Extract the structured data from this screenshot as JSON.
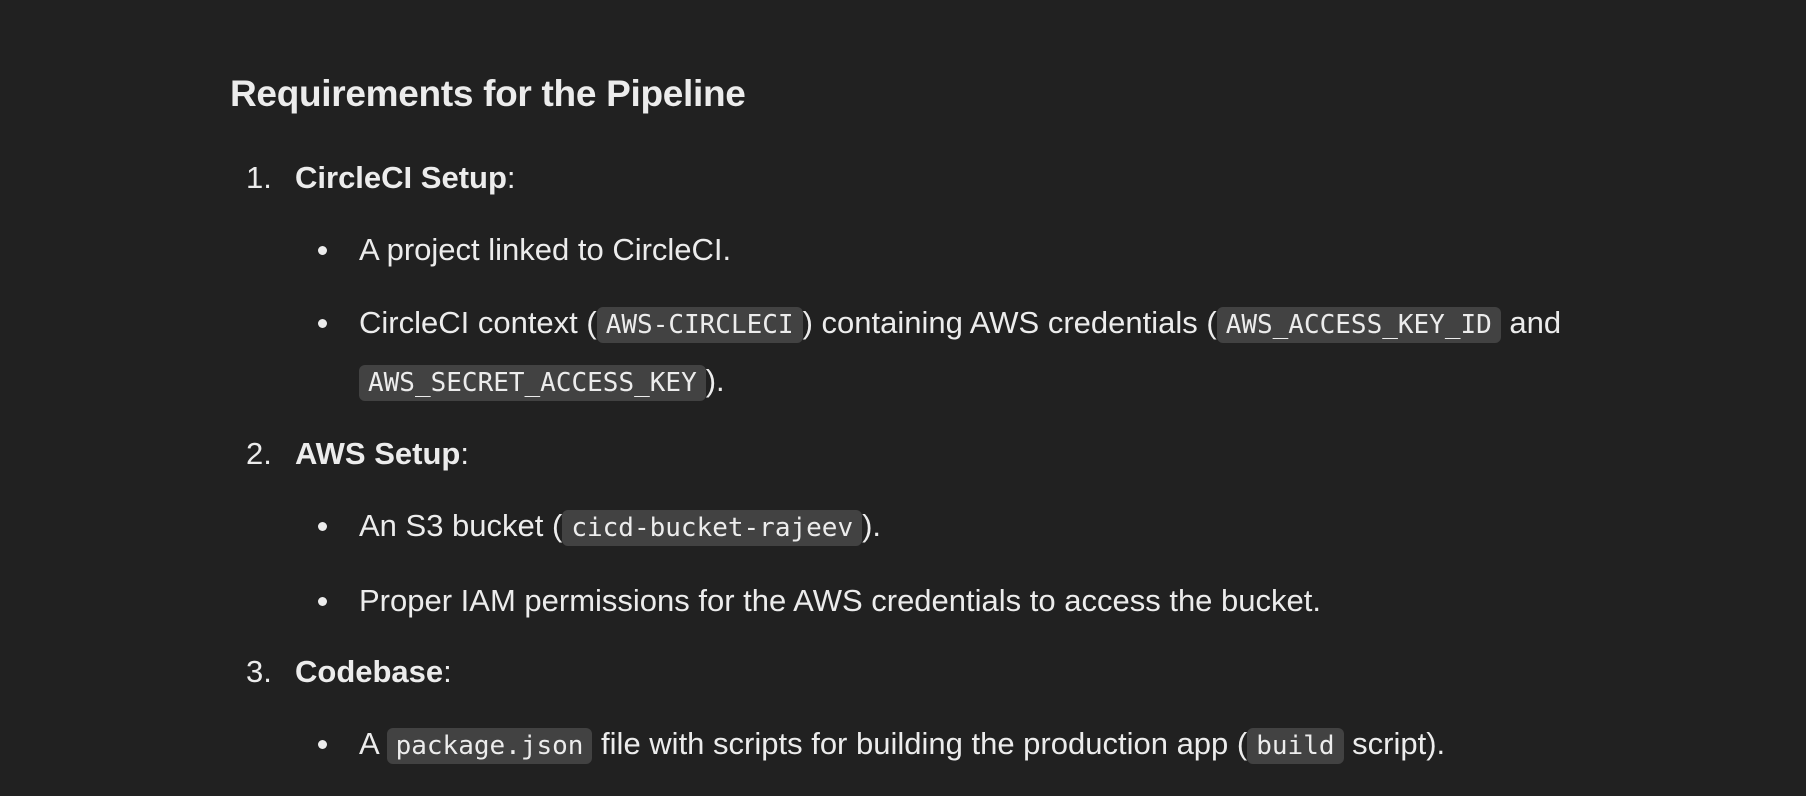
{
  "heading": "Requirements for the Pipeline",
  "steps": [
    {
      "number": "1.",
      "title": "CircleCI Setup",
      "suffix": ":",
      "items": [
        {
          "parts": [
            {
              "t": "A project linked to CircleCI."
            }
          ]
        },
        {
          "parts": [
            {
              "t": "CircleCI context ("
            },
            {
              "c": "AWS-CIRCLECI"
            },
            {
              "t": ") containing AWS credentials ("
            },
            {
              "c": "AWS_ACCESS_KEY_ID"
            },
            {
              "t": " and "
            },
            {
              "c": "AWS_SECRET_ACCESS_KEY"
            },
            {
              "t": ")."
            }
          ]
        }
      ]
    },
    {
      "number": "2.",
      "title": "AWS Setup",
      "suffix": ":",
      "items": [
        {
          "parts": [
            {
              "t": "An S3 bucket ("
            },
            {
              "c": "cicd-bucket-rajeev"
            },
            {
              "t": ")."
            }
          ]
        },
        {
          "parts": [
            {
              "t": "Proper IAM permissions for the AWS credentials to access the bucket."
            }
          ]
        }
      ]
    },
    {
      "number": "3.",
      "title": "Codebase",
      "suffix": ":",
      "items": [
        {
          "parts": [
            {
              "t": "A "
            },
            {
              "c": "package.json"
            },
            {
              "t": " file with scripts for building the production app ("
            },
            {
              "c": "build"
            },
            {
              "t": " script)."
            }
          ]
        }
      ]
    }
  ]
}
